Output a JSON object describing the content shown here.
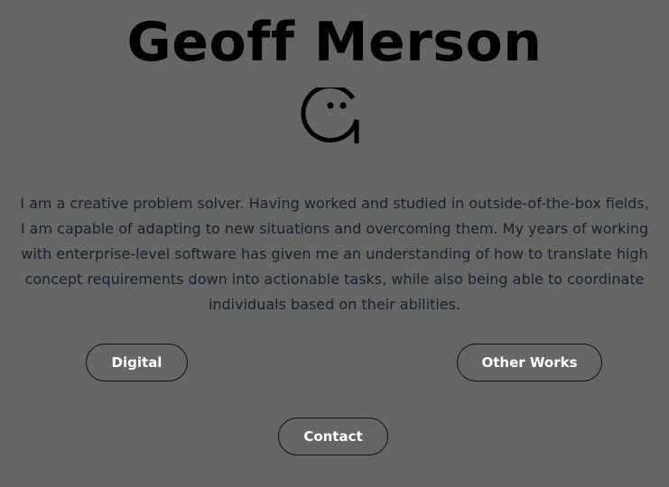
{
  "header": {
    "name": "Geoff Merson",
    "logo_icon": "g-smiley-logo-icon"
  },
  "about": {
    "bio": "I am a creative problem solver. Having worked and studied in outside-of-the-box fields, I am capable of adapting to new situations and overcoming them. My years of working with enterprise-level software has given me an understanding of how to translate high concept requirements down into actionable tasks, while also being able to coordinate individuals based on their abilities."
  },
  "nav": {
    "digital_label": "Digital",
    "other_works_label": "Other Works",
    "contact_label": "Contact"
  },
  "colors": {
    "background": "#666666",
    "title": "#000000",
    "body_text": "#16202e",
    "button_text": "#ffffff",
    "button_border": "#111111"
  }
}
